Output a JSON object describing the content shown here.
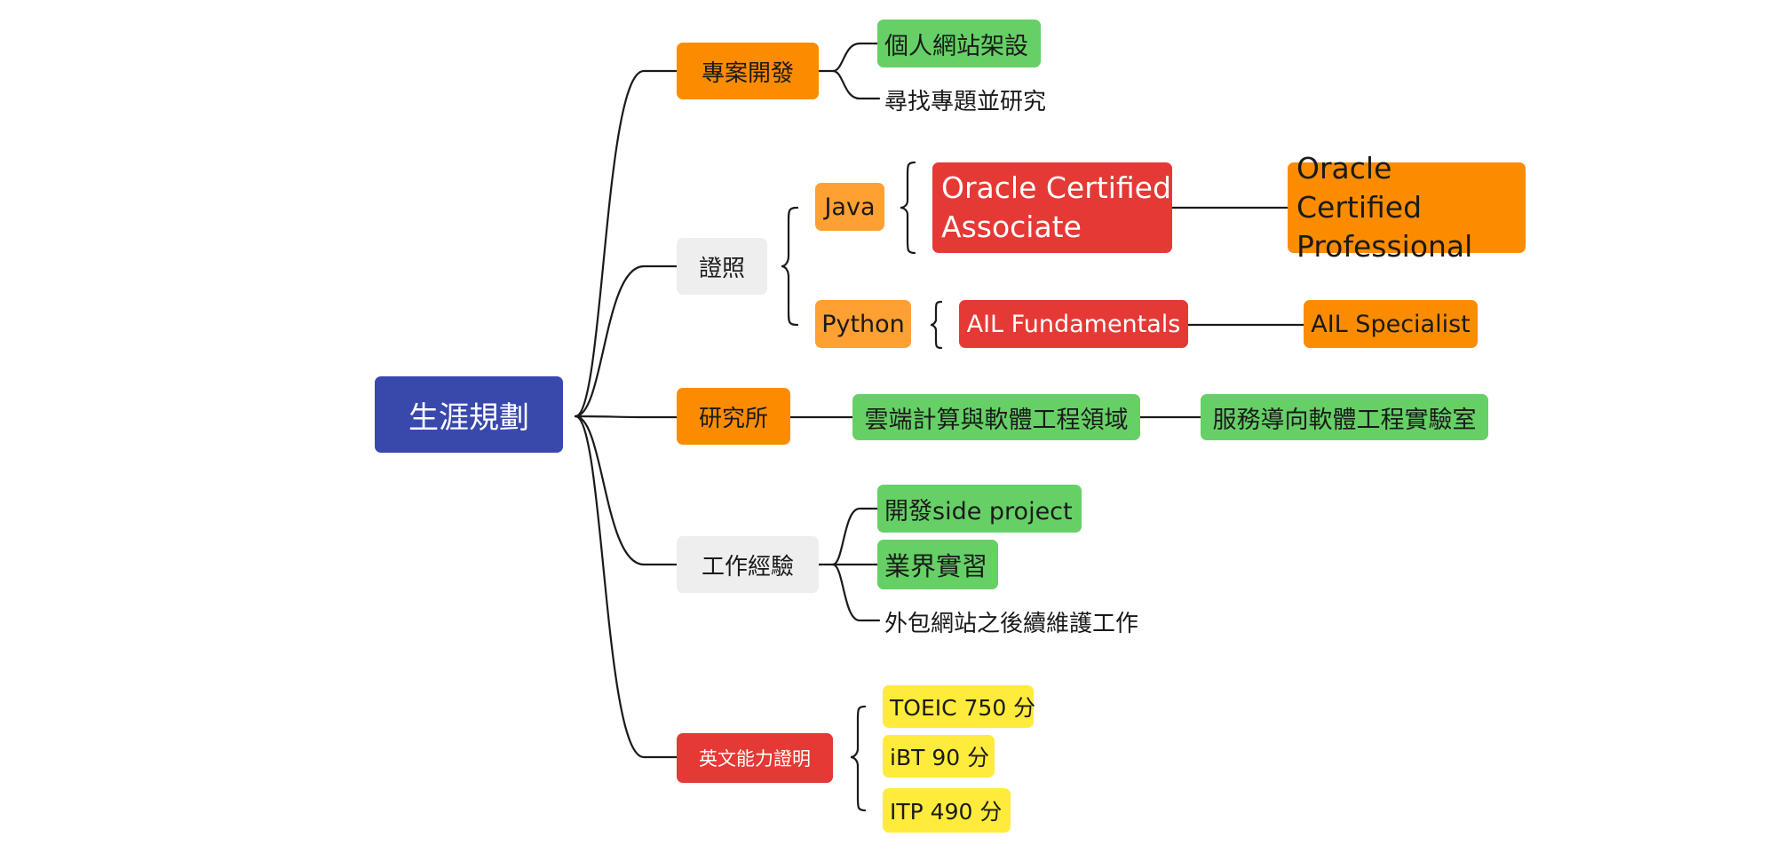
{
  "colors": {
    "root": "#3949AB",
    "orange": "#FB8C00",
    "light_orange": "#FFA033",
    "grey": "#EEEEEE",
    "red": "#E53935",
    "green": "#66D066",
    "yellow": "#FFEB3B",
    "line": "#1a1a1a"
  },
  "mindmap": {
    "root": {
      "label": "生涯規劃"
    },
    "branches": {
      "project": {
        "label": "專案開發",
        "children": [
          "個人網站架設",
          "尋找專題並研究"
        ]
      },
      "certs": {
        "label": "證照",
        "java": {
          "label": "Java",
          "associate": "Oracle Certified Associate",
          "professional": "Oracle Certified Professional"
        },
        "python": {
          "label": "Python",
          "fundamentals": "AIL Fundamentals",
          "specialist": "AIL Specialist"
        }
      },
      "grad": {
        "label": "研究所",
        "field": "雲端計算與軟體工程領域",
        "lab": "服務導向軟體工程實驗室"
      },
      "work": {
        "label": "工作經驗",
        "children": [
          "開發side project",
          "業界實習",
          "外包網站之後續維護工作"
        ]
      },
      "english": {
        "label": "英文能力證明",
        "children": [
          "TOEIC 750 分",
          "iBT 90 分",
          "ITP 490 分"
        ]
      }
    }
  }
}
